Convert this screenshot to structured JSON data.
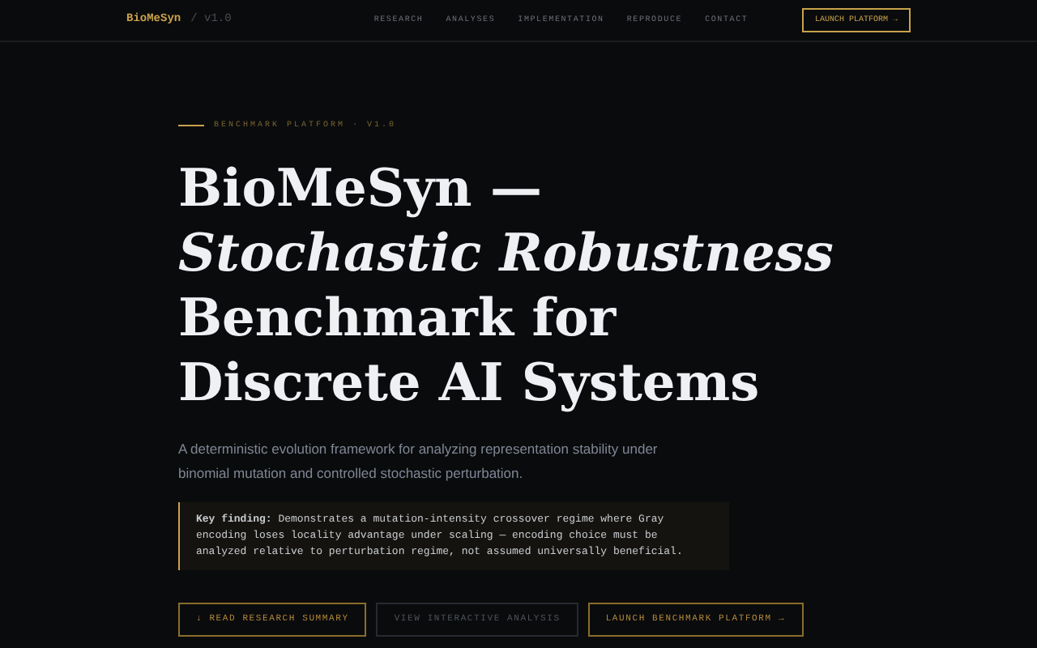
{
  "nav": {
    "brand": "BioMeSyn",
    "version": "/ v1.0",
    "links": [
      "RESEARCH",
      "ANALYSES",
      "IMPLEMENTATION",
      "REPRODUCE",
      "CONTACT"
    ],
    "cta": "LAUNCH PLATFORM →"
  },
  "hero": {
    "kicker": "BENCHMARK PLATFORM · V1.0",
    "title": "BioMeSyn — *Stochastic Robustness* Benchmark for Discrete AI Systems",
    "subtitle": "A deterministic evolution framework for analyzing representation stability under binomial mutation and controlled stochastic perturbation.",
    "finding": "**Key finding:** Demonstrates a mutation-intensity crossover regime where Gray encoding loses locality advantage under scaling — encoding choice must be analyzed relative to perturbation regime, not assumed universally beneficial.",
    "buttons": [
      {
        "label": "↓ READ RESEARCH SUMMARY",
        "kind": "gold"
      },
      {
        "label": "VIEW INTERACTIVE ANALYSIS",
        "kind": "muted"
      },
      {
        "label": "LAUNCH BENCHMARK PLATFORM →",
        "kind": "gold"
      }
    ]
  }
}
